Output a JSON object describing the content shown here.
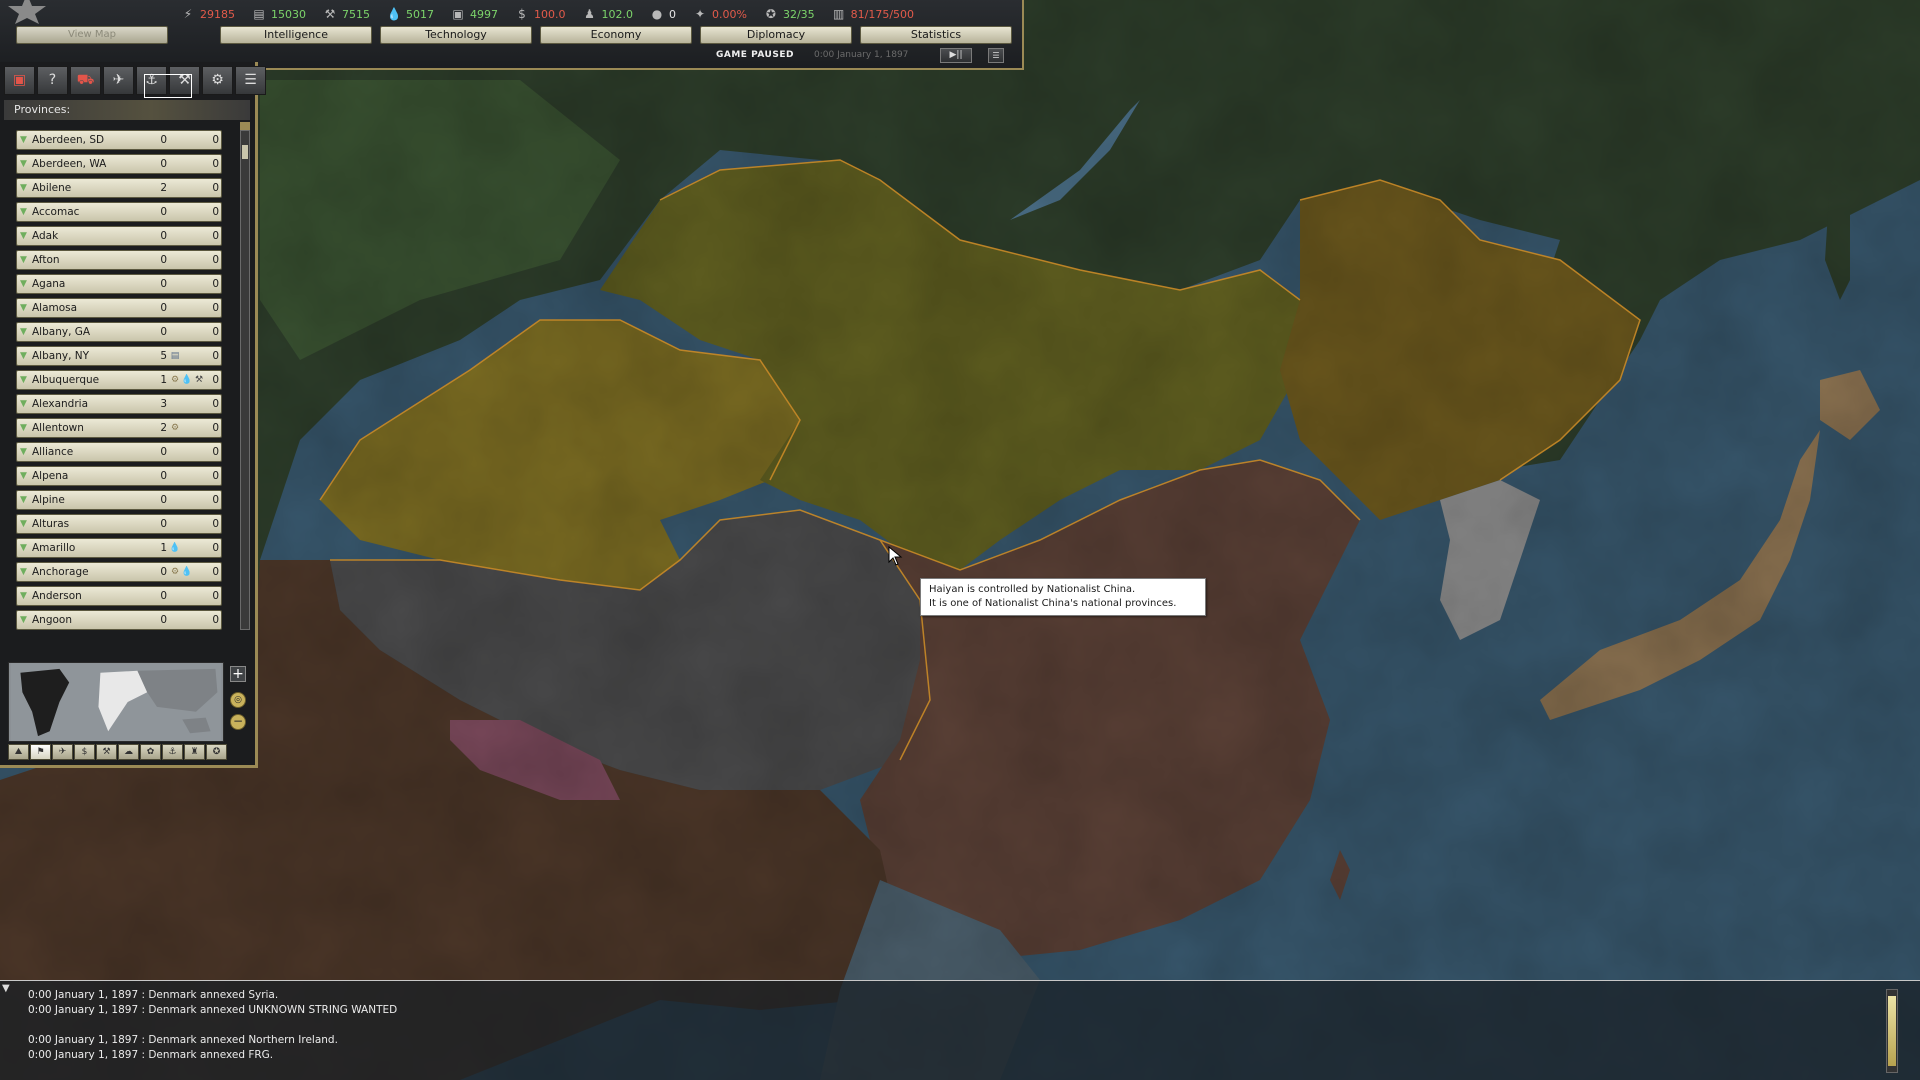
{
  "topbar": {
    "resources": [
      {
        "name": "energy",
        "icon": "energy-icon",
        "value": "29185",
        "color": "red"
      },
      {
        "name": "metal",
        "icon": "metal-icon",
        "value": "15030",
        "color": "green"
      },
      {
        "name": "rare_materials",
        "icon": "rare-materials-icon",
        "value": "7515",
        "color": "green"
      },
      {
        "name": "oil",
        "icon": "oil-icon",
        "value": "5017",
        "color": "green"
      },
      {
        "name": "supplies",
        "icon": "supplies-icon",
        "value": "4997",
        "color": "green"
      },
      {
        "name": "money",
        "icon": "money-icon",
        "value": "100.0",
        "color": "red"
      },
      {
        "name": "manpower",
        "icon": "manpower-icon",
        "value": "102.0",
        "color": "green"
      },
      {
        "name": "diplomacy",
        "icon": "diplomacy-icon",
        "value": "0",
        "color": "white"
      },
      {
        "name": "dissent",
        "icon": "dissent-icon",
        "value": "0.00%",
        "color": "red"
      },
      {
        "name": "leadership",
        "icon": "leadership-icon",
        "value": "32/35",
        "color": "green"
      },
      {
        "name": "units",
        "icon": "units-icon",
        "value": "81/175/500",
        "color": "red"
      }
    ],
    "view_map_label": "View Map",
    "tabs": [
      "Intelligence",
      "Technology",
      "Economy",
      "Diplomacy",
      "Statistics"
    ],
    "status": "GAME PAUSED",
    "datetime": "0:00 January 1, 1897",
    "play_label": "▶||",
    "menu_label": "☰"
  },
  "left_panel": {
    "provinces_label": "Provinces:",
    "provinces": [
      {
        "name": "Aberdeen, SD",
        "v1": "0",
        "v2": "0",
        "icons": []
      },
      {
        "name": "Aberdeen, WA",
        "v1": "0",
        "v2": "0",
        "icons": []
      },
      {
        "name": "Abilene",
        "v1": "2",
        "v2": "0",
        "icons": []
      },
      {
        "name": "Accomac",
        "v1": "0",
        "v2": "0",
        "icons": []
      },
      {
        "name": "Adak",
        "v1": "0",
        "v2": "0",
        "icons": []
      },
      {
        "name": "Afton",
        "v1": "0",
        "v2": "0",
        "icons": []
      },
      {
        "name": "Agana",
        "v1": "0",
        "v2": "0",
        "icons": []
      },
      {
        "name": "Alamosa",
        "v1": "0",
        "v2": "0",
        "icons": []
      },
      {
        "name": "Albany, GA",
        "v1": "0",
        "v2": "0",
        "icons": []
      },
      {
        "name": "Albany, NY",
        "v1": "5",
        "v2": "0",
        "icons": [
          "metal-icon"
        ]
      },
      {
        "name": "Albuquerque",
        "v1": "1",
        "v2": "0",
        "icons": [
          "gear-icon",
          "oil-icon",
          "rare-materials-icon"
        ]
      },
      {
        "name": "Alexandria",
        "v1": "3",
        "v2": "0",
        "icons": []
      },
      {
        "name": "Allentown",
        "v1": "2",
        "v2": "0",
        "icons": [
          "gear-icon"
        ]
      },
      {
        "name": "Alliance",
        "v1": "0",
        "v2": "0",
        "icons": []
      },
      {
        "name": "Alpena",
        "v1": "0",
        "v2": "0",
        "icons": []
      },
      {
        "name": "Alpine",
        "v1": "0",
        "v2": "0",
        "icons": []
      },
      {
        "name": "Alturas",
        "v1": "0",
        "v2": "0",
        "icons": []
      },
      {
        "name": "Amarillo",
        "v1": "1",
        "v2": "0",
        "icons": [
          "oil-icon"
        ]
      },
      {
        "name": "Anchorage",
        "v1": "0",
        "v2": "0",
        "icons": [
          "gear-icon",
          "oil-icon"
        ]
      },
      {
        "name": "Anderson",
        "v1": "0",
        "v2": "0",
        "icons": []
      },
      {
        "name": "Angoon",
        "v1": "0",
        "v2": "0",
        "icons": []
      }
    ],
    "toolbar_icons": [
      "province-view-icon",
      "help-icon",
      "land-units-icon",
      "air-units-icon",
      "naval-units-icon",
      "unit-builds-icon",
      "settings-icon",
      "list-icon"
    ],
    "map_mode_icons": [
      "terrain-mode-icon",
      "political-mode-icon",
      "supply-mode-icon",
      "economic-mode-icon",
      "resource-mode-icon",
      "weather-mode-icon",
      "diplomatic-mode-icon",
      "naval-mode-icon",
      "partisan-mode-icon",
      "theatre-mode-icon"
    ]
  },
  "tooltip": {
    "line1": "Haiyan is controlled by Nationalist China.",
    "line2": "It is one of Nationalist China's national provinces."
  },
  "log": [
    "0:00 January 1, 1897 : Denmark annexed Syria.",
    "0:00 January 1, 1897 : Denmark annexed UNKNOWN STRING WANTED",
    "0:00 January 1, 1897 : Denmark annexed Northern Ireland.",
    "0:00 January 1, 1897 : Denmark annexed FRG."
  ],
  "colors": {
    "accent": "#9b8a55",
    "ocean": "#3a5a70",
    "russia": "#2b3a27",
    "mongolia": "#6c6a20",
    "xinjiang": "#7b6a1f",
    "tibet": "#4a4a4a",
    "china": "#5a3f36",
    "india": "#4a3628",
    "japan": "#8a7050",
    "korea": "#8a8a8a",
    "manchuria": "#6e5a1e",
    "nepal": "#7a4a5a"
  }
}
